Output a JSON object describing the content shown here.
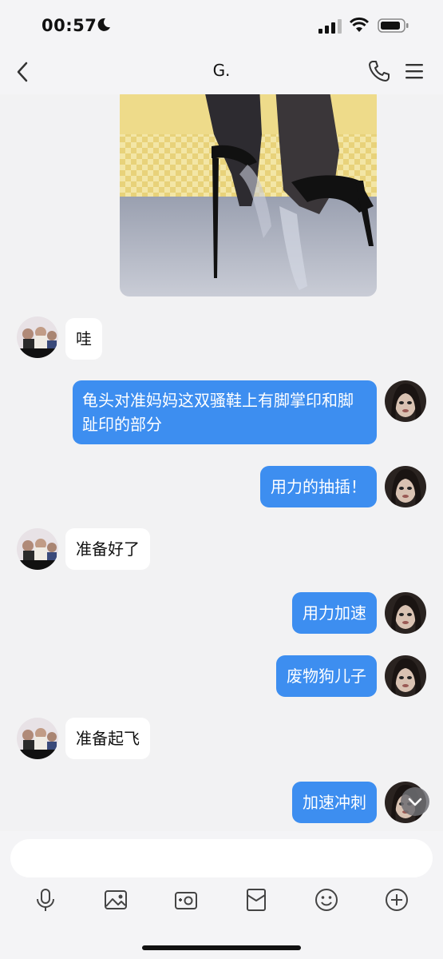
{
  "status_bar": {
    "time": "00:57",
    "icons": [
      "moon-icon",
      "cellular-signal-icon",
      "wifi-icon",
      "battery-icon"
    ]
  },
  "nav": {
    "title": "G.",
    "back_icon": "chevron-left-icon",
    "call_icon": "phone-icon",
    "menu_icon": "menu-icon"
  },
  "messages": [
    {
      "side": "in",
      "text": "哇"
    },
    {
      "side": "out",
      "text": "龟头对准妈妈这双骚鞋上有脚掌印和脚趾印的部分"
    },
    {
      "side": "out",
      "text": "用力的抽插！"
    },
    {
      "side": "in",
      "text": "准备好了"
    },
    {
      "side": "out",
      "text": "用力加速"
    },
    {
      "side": "out",
      "text": "废物狗儿子"
    },
    {
      "side": "in",
      "text": "准备起飞"
    },
    {
      "side": "out",
      "text": "加速冲刺"
    }
  ],
  "input": {
    "value": "",
    "toolbar": [
      "microphone-icon",
      "image-icon",
      "camera-icon",
      "red-packet-icon",
      "emoji-icon",
      "plus-icon"
    ]
  },
  "colors": {
    "outgoing_bubble": "#3d8ef0",
    "incoming_bubble": "#ffffff",
    "background": "#f2f2f3"
  }
}
